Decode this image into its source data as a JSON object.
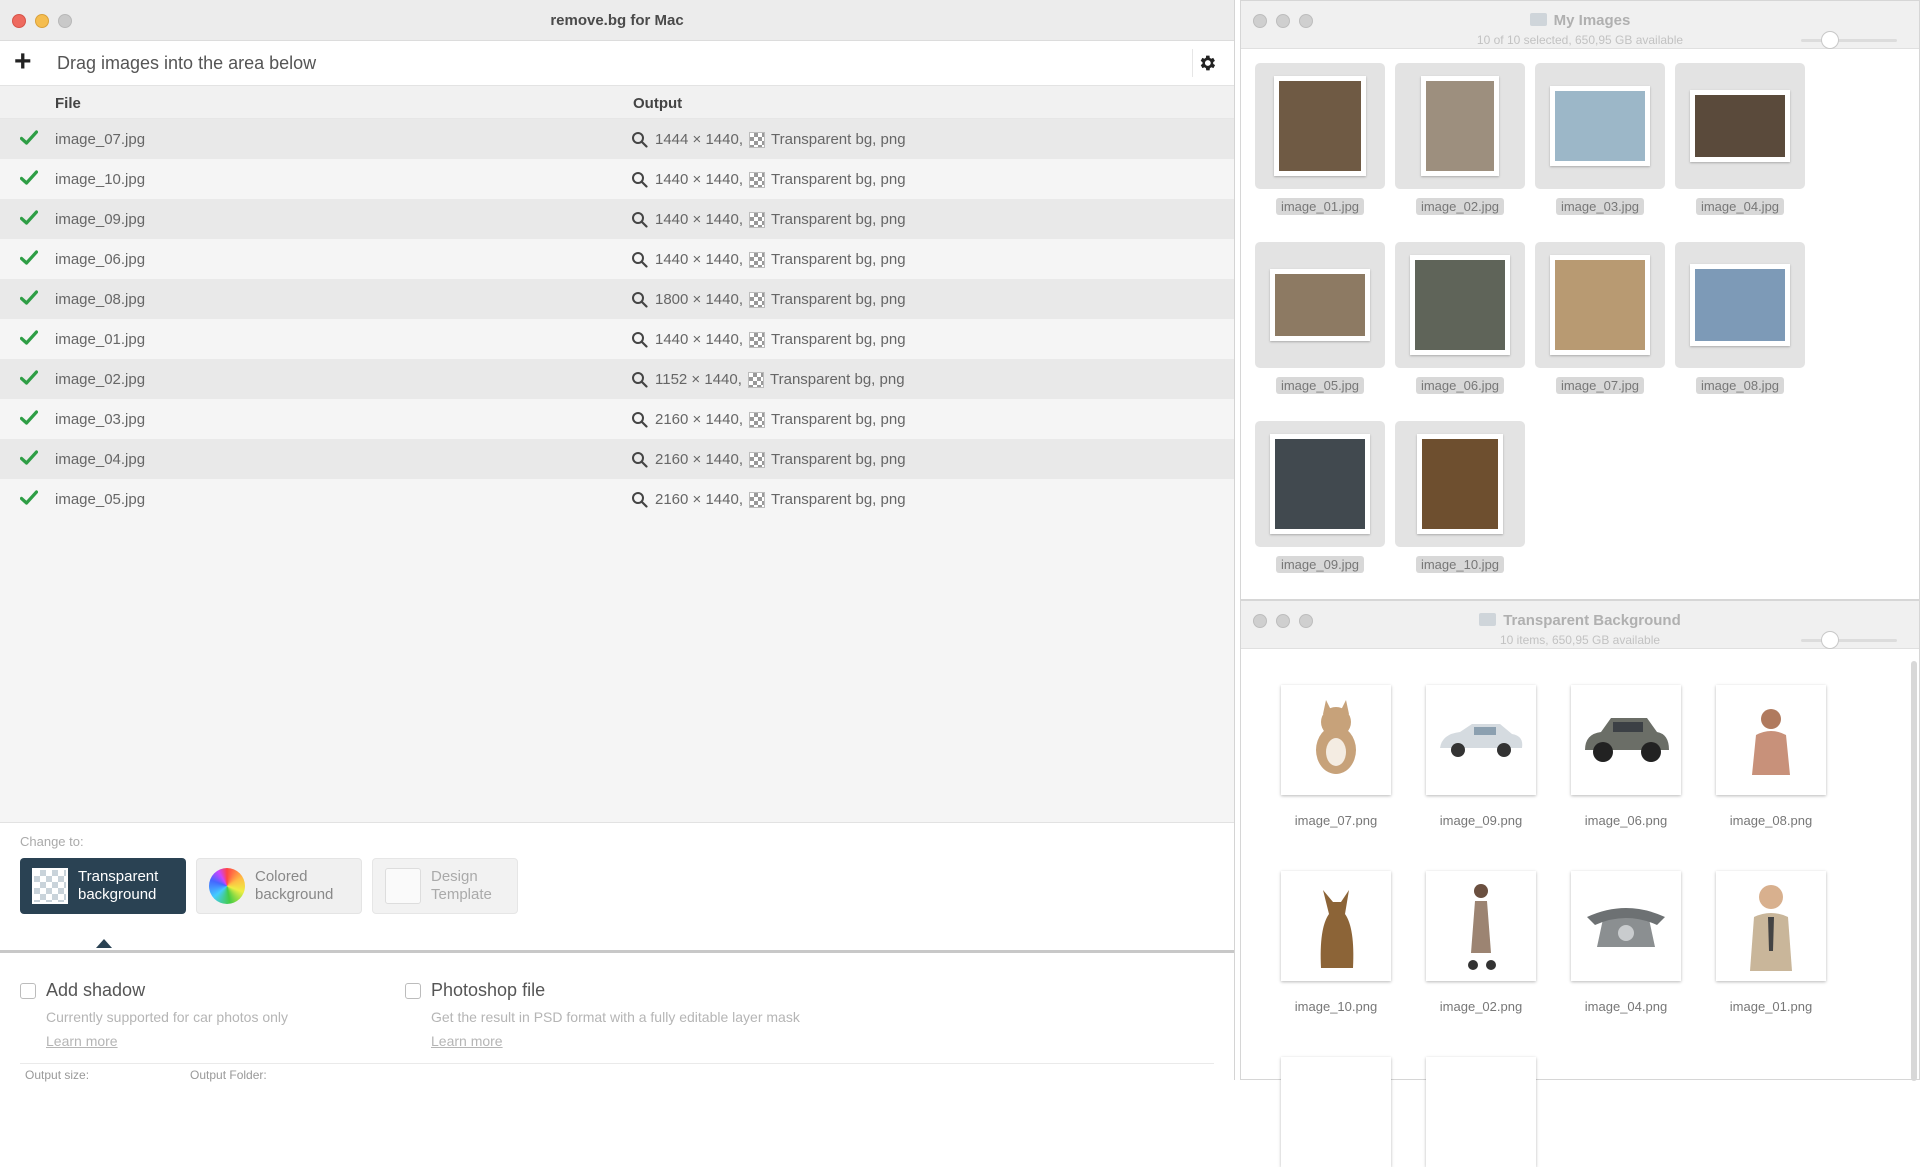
{
  "window": {
    "title": "remove.bg for Mac"
  },
  "toolbar": {
    "drop_hint": "Drag images into the area below",
    "add_icon": "plus-icon",
    "settings_icon": "gear-icon"
  },
  "table": {
    "headers": {
      "file": "File",
      "output": "Output"
    },
    "rows": [
      {
        "file": "image_07.jpg",
        "dims": "1444 × 1440,",
        "bg": "Transparent bg, png"
      },
      {
        "file": "image_10.jpg",
        "dims": "1440 × 1440,",
        "bg": "Transparent bg, png"
      },
      {
        "file": "image_09.jpg",
        "dims": "1440 × 1440,",
        "bg": "Transparent bg, png"
      },
      {
        "file": "image_06.jpg",
        "dims": "1440 × 1440,",
        "bg": "Transparent bg, png"
      },
      {
        "file": "image_08.jpg",
        "dims": "1800 × 1440,",
        "bg": "Transparent bg, png"
      },
      {
        "file": "image_01.jpg",
        "dims": "1440 × 1440,",
        "bg": "Transparent bg, png"
      },
      {
        "file": "image_02.jpg",
        "dims": "1152 × 1440,",
        "bg": "Transparent bg, png"
      },
      {
        "file": "image_03.jpg",
        "dims": "2160 × 1440,",
        "bg": "Transparent bg, png"
      },
      {
        "file": "image_04.jpg",
        "dims": "2160 × 1440,",
        "bg": "Transparent bg, png"
      },
      {
        "file": "image_05.jpg",
        "dims": "2160 × 1440,",
        "bg": "Transparent bg, png"
      }
    ]
  },
  "change_to": {
    "label": "Change to:",
    "options": [
      {
        "line1": "Transparent",
        "line2": "background",
        "selected": true
      },
      {
        "line1": "Colored",
        "line2": "background",
        "selected": false
      },
      {
        "line1": "Design",
        "line2": "Template",
        "selected": false
      }
    ]
  },
  "options": {
    "shadow": {
      "label": "Add shadow",
      "sub": "Currently supported for car photos only",
      "link": "Learn more",
      "checked": false
    },
    "psd": {
      "label": "Photoshop file",
      "sub": "Get the result in PSD format with a fully editable layer mask",
      "link": "Learn more",
      "checked": false
    },
    "footer_left": "Output size:",
    "footer_right": "Output Folder:"
  },
  "my_images": {
    "title": "My Images",
    "status": "10 of 10 selected, 650,95 GB available",
    "zoom": 0.3,
    "items": [
      {
        "name": "image_01.jpg",
        "color": "#6f5a44"
      },
      {
        "name": "image_02.jpg",
        "color": "#9d8f7e"
      },
      {
        "name": "image_03.jpg",
        "color": "#9cb7c8"
      },
      {
        "name": "image_04.jpg",
        "color": "#5a4a3b"
      },
      {
        "name": "image_05.jpg",
        "color": "#8d7a63"
      },
      {
        "name": "image_06.jpg",
        "color": "#5f6459"
      },
      {
        "name": "image_07.jpg",
        "color": "#b89a72"
      },
      {
        "name": "image_08.jpg",
        "color": "#7d9ab7"
      },
      {
        "name": "image_09.jpg",
        "color": "#41494f"
      },
      {
        "name": "image_10.jpg",
        "color": "#6e4f2f"
      }
    ]
  },
  "transparent_bg": {
    "title": "Transparent Background",
    "status": "10 items, 650,95 GB available",
    "zoom": 0.3,
    "items": [
      {
        "name": "image_07.png",
        "color": "#c7a27a"
      },
      {
        "name": "image_09.png",
        "color": "#d5dbe0"
      },
      {
        "name": "image_06.png",
        "color": "#6b6e67"
      },
      {
        "name": "image_08.png",
        "color": "#c8917a"
      },
      {
        "name": "image_10.png",
        "color": "#8c6437"
      },
      {
        "name": "image_02.png",
        "color": "#9c8472"
      },
      {
        "name": "image_04.png",
        "color": "#8b8f91"
      },
      {
        "name": "image_01.png",
        "color": "#c9b69a"
      }
    ]
  }
}
